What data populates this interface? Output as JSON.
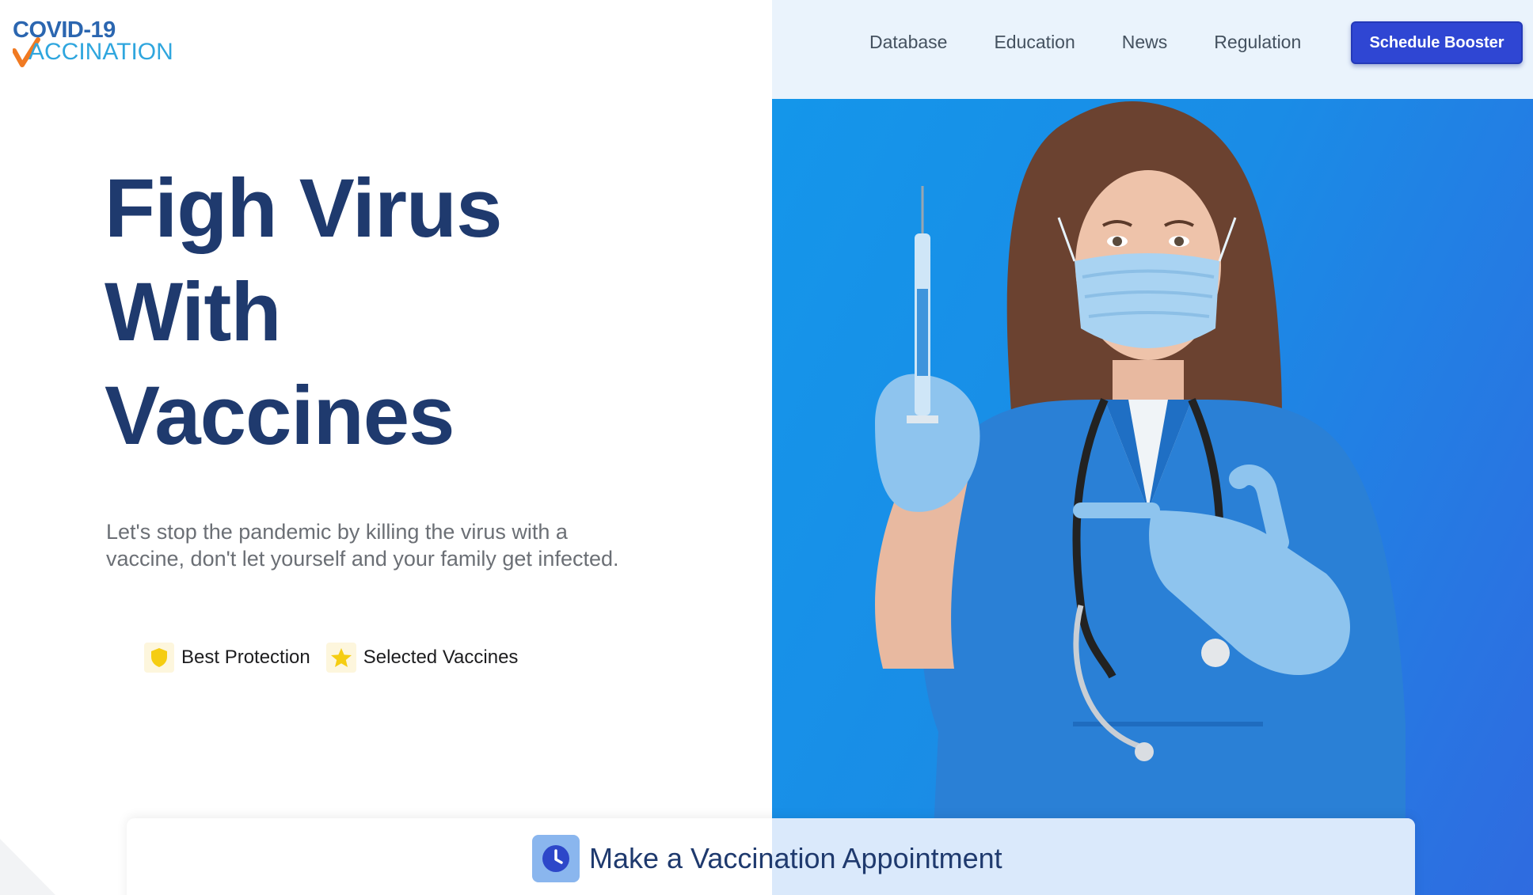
{
  "brand": {
    "logo_line1": "COVID-19",
    "logo_line2": "ACCINATION",
    "colors": {
      "primary": "#1f3a6e",
      "accent_blue": "#2fa6de",
      "check_orange": "#f07a22",
      "cta": "#2f46d3"
    }
  },
  "nav": {
    "items": [
      {
        "label": "Database"
      },
      {
        "label": "Education"
      },
      {
        "label": "News"
      },
      {
        "label": "Regulation"
      }
    ],
    "cta_label": "Schedule Booster"
  },
  "hero": {
    "headline_lines": [
      "Figh Virus",
      "With",
      "Vaccines"
    ],
    "lede": "Let's stop the pandemic by killing the virus with a vaccine, don't let yourself and your family get infected.",
    "features": [
      {
        "icon": "shield-icon",
        "label": "Best Protection"
      },
      {
        "icon": "star-icon",
        "label": "Selected Vaccines"
      }
    ],
    "image": "nurse-with-syringe-photo"
  },
  "appointment": {
    "icon": "clock-icon",
    "label": "Make a Vaccination Appointment"
  }
}
